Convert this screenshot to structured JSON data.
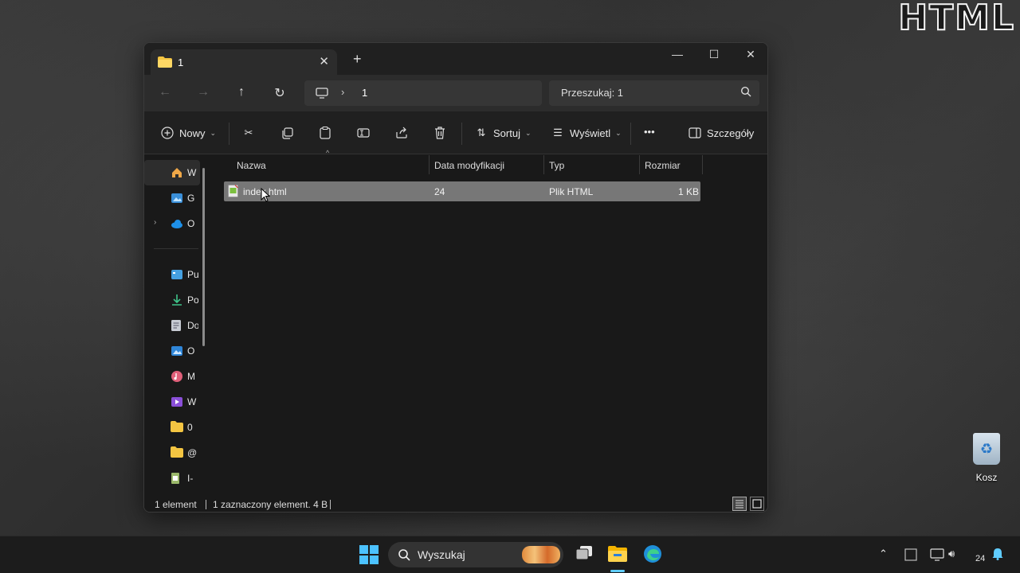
{
  "watermark": "HTML",
  "desktop": {
    "recycle_bin_label": "Kosz"
  },
  "window": {
    "tab_title": "1",
    "new_tab": "+",
    "controls": {
      "minimize": "—",
      "maximize": "☐",
      "close": "✕"
    },
    "address": {
      "separator": "›",
      "crumb": "1"
    },
    "search_placeholder": "Przeszukaj: 1",
    "toolbar": {
      "new_label": "Nowy",
      "sort_label": "Sortuj",
      "view_label": "Wyświetl",
      "more_label": "•••",
      "details_label": "Szczegóły"
    },
    "sidebar": {
      "items": [
        {
          "label": "W",
          "icon": "home-icon"
        },
        {
          "label": "G",
          "icon": "gallery-icon"
        },
        {
          "label": "O",
          "icon": "onedrive-icon"
        },
        {
          "label": "Pu",
          "icon": "desktop-folder-icon"
        },
        {
          "label": "Po",
          "icon": "downloads-icon"
        },
        {
          "label": "Do",
          "icon": "documents-icon"
        },
        {
          "label": "O",
          "icon": "pictures-icon"
        },
        {
          "label": "M",
          "icon": "music-icon"
        },
        {
          "label": "W",
          "icon": "videos-icon"
        },
        {
          "label": "0",
          "icon": "folder-icon"
        },
        {
          "label": "@",
          "icon": "folder-icon"
        },
        {
          "label": "I-",
          "icon": "file-icon"
        }
      ]
    },
    "columns": {
      "name": "Nazwa",
      "date": "Data modyfikacji",
      "type": "Typ",
      "size": "Rozmiar"
    },
    "files": [
      {
        "name": "index.html",
        "date": "24",
        "type": "Plik HTML",
        "size": "1 KB"
      }
    ],
    "status": {
      "count": "1 element",
      "selected": "1 zaznaczony element. 4 B"
    }
  },
  "taskbar": {
    "search_placeholder": "Wyszukaj",
    "clock": "24"
  },
  "colors": {
    "accent": "#60cdff",
    "folder": "#f4c542",
    "selection": "#777777"
  }
}
